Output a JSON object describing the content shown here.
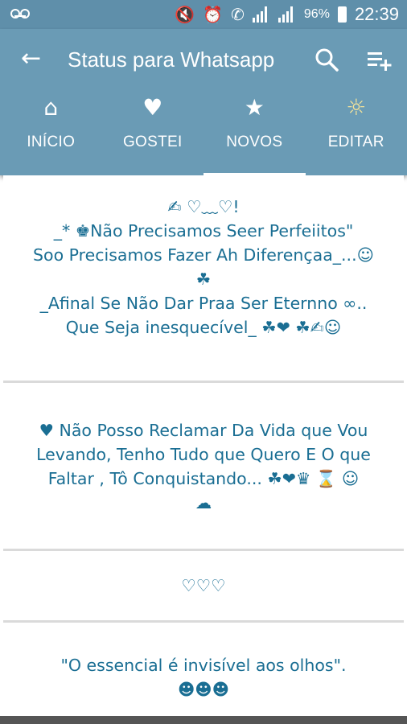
{
  "status_bar": {
    "battery": "96%",
    "time": "22:39",
    "icons": [
      "voicemail-icon",
      "mute-icon",
      "alarm-icon",
      "phone-icon",
      "signal-icon",
      "signal-icon",
      "battery-icon"
    ]
  },
  "app_bar": {
    "title": "Status para Whatsapp",
    "back_icon": "←",
    "search_icon": "search-icon",
    "playlist_icon": "playlist-add-icon"
  },
  "tabs": [
    {
      "label": "INÍCIO",
      "icon": "⌂",
      "icon_name": "home-icon"
    },
    {
      "label": "GOSTEI",
      "icon": "♥",
      "icon_name": "heart-icon"
    },
    {
      "label": "NOVOS",
      "icon": "★",
      "icon_name": "star-icon"
    },
    {
      "label": "EDITAR",
      "icon": "☼",
      "icon_name": "sun-icon"
    }
  ],
  "active_tab": "NOVOS",
  "posts": [
    {
      "text": "✍ ♡﹏♡!\n_* ♚Não Precisamos Seer Perfeiitos\"\nSoo Precisamos Fazer Ah Diferençaa_...☺\n☘\n_Afinal Se Não Dar Praa Ser Eternno ∞..\nQue  Seja inesquecível_ ☘❤ ☘✍☺"
    },
    {
      "text": "♥ Não Posso Reclamar Da Vida que Vou\nLevando, Tenho Tudo que Quero E O que\nFaltar , Tô Conquistando... ☘❤♛ ⌛ ☺\n☁"
    },
    {
      "text": "♡♡♡"
    },
    {
      "text": "\"O essencial é invisível aos olhos\".\n☻☻☻"
    }
  ],
  "colors": {
    "status_bar": "#5f8faa",
    "app_bar": "#6a9bb5",
    "post_text": "#1a6e93",
    "divider": "#dadada"
  }
}
